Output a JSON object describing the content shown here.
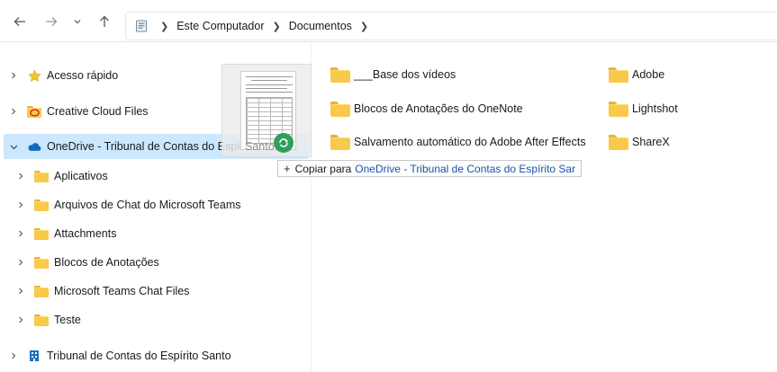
{
  "nav": {
    "back_icon": "arrow-left-icon",
    "forward_icon": "arrow-right-icon",
    "recent_icon": "chevron-down-icon",
    "up_icon": "arrow-up-icon"
  },
  "address": {
    "crumbs": [
      "Este Computador",
      "Documentos"
    ]
  },
  "sidebar": {
    "items": [
      {
        "label": "Acesso rápido",
        "icon": "star-icon"
      },
      {
        "label": "Creative Cloud Files",
        "icon": "creative-cloud-icon"
      },
      {
        "label": "OneDrive - Tribunal de Contas do Espírito Santo",
        "icon": "onedrive-cloud-icon"
      },
      {
        "label": "Aplicativos",
        "icon": "folder-icon"
      },
      {
        "label": "Arquivos de Chat do Microsoft Teams",
        "icon": "folder-icon"
      },
      {
        "label": "Attachments",
        "icon": "folder-icon"
      },
      {
        "label": "Blocos de Anotações",
        "icon": "folder-icon"
      },
      {
        "label": "Microsoft Teams Chat Files",
        "icon": "folder-icon"
      },
      {
        "label": "Teste",
        "icon": "folder-icon"
      },
      {
        "label": "Tribunal de Contas do Espírito Santo",
        "icon": "building-icon"
      }
    ]
  },
  "folders": [
    {
      "name": "___Base dos vídeos"
    },
    {
      "name": "Blocos de Anotações do OneNote"
    },
    {
      "name": "Salvamento automático do Adobe After Effects"
    },
    {
      "name": "Adobe"
    },
    {
      "name": "Lightshot"
    },
    {
      "name": "ShareX"
    }
  ],
  "drag": {
    "ghost_label": "Santo",
    "tip_action": "Copiar para",
    "tip_target": "OneDrive - Tribunal de Contas do Espírito Sar"
  },
  "colors": {
    "selection": "#cce8ff",
    "folder": "#f9c94b",
    "onedrive": "#0f6cbd",
    "accent": "#2e9e5b"
  }
}
